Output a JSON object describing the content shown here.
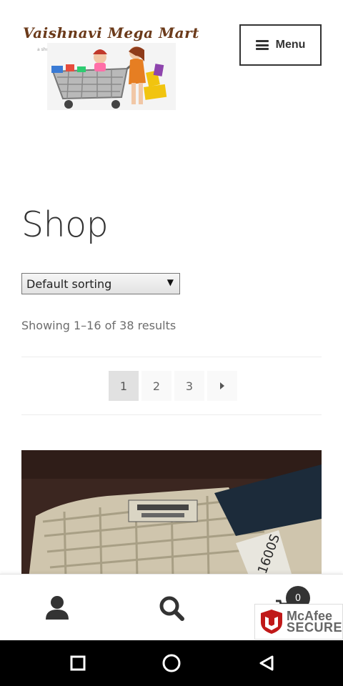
{
  "header": {
    "logo_text": "Vaishnavi Mega Mart",
    "logo_tagline": "a shopping mart",
    "menu_label": "Menu"
  },
  "main": {
    "page_title": "Shop",
    "sorting": {
      "selected": "Default sorting"
    },
    "result_count": "Showing 1–16 of 38 results",
    "pagination": {
      "pages": [
        "1",
        "2",
        "3"
      ],
      "current": "1"
    }
  },
  "footer": {
    "cart_count": "0",
    "badge": {
      "brand": "McAfee",
      "label": "SECURE"
    }
  },
  "colors": {
    "accent": "#333333",
    "text": "#43454b",
    "mcafee_red": "#c01818"
  },
  "icons": [
    "hamburger-icon",
    "user-icon",
    "search-icon",
    "cart-icon",
    "mcafee-shield-icon",
    "recents-icon",
    "home-icon",
    "back-icon"
  ]
}
